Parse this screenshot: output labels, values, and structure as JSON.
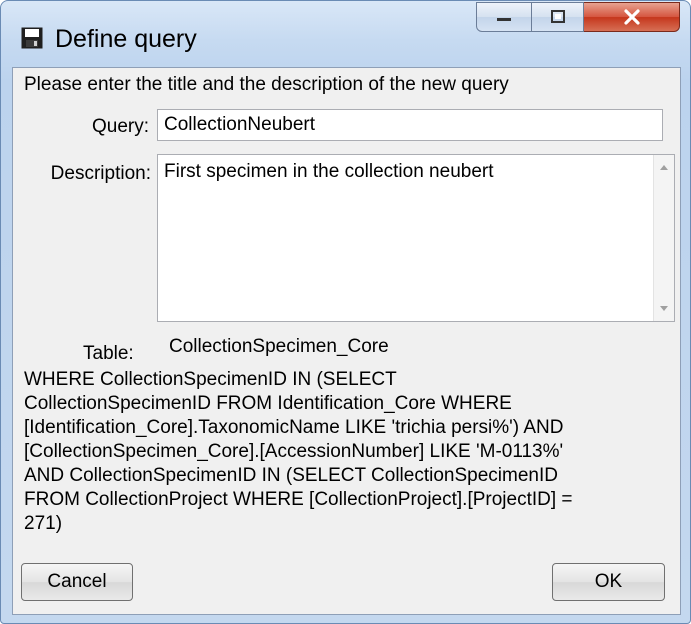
{
  "window": {
    "title": "Define query",
    "icon": "floppy-disk-icon"
  },
  "caption_buttons": [
    "minimize-icon",
    "maximize-icon",
    "close-icon"
  ],
  "dialog": {
    "prompt": "Please enter the title and the description of the new query",
    "query_label": "Query:",
    "query_value": "CollectionNeubert",
    "description_label": "Description:",
    "description_value": "First specimen in the collection neubert",
    "table_label": "Table:",
    "table_value": "CollectionSpecimen_Core",
    "sql_lines": [
      " WHERE CollectionSpecimenID IN (SELECT",
      "CollectionSpecimenID FROM Identification_Core WHERE",
      "[Identification_Core].TaxonomicName LIKE 'trichia persi%') AND",
      "[CollectionSpecimen_Core].[AccessionNumber] LIKE 'M-0113%'",
      "AND CollectionSpecimenID IN (SELECT CollectionSpecimenID",
      "FROM CollectionProject WHERE [CollectionProject].[ProjectID] =",
      "271)"
    ]
  },
  "buttons": {
    "cancel": "Cancel",
    "ok": "OK"
  },
  "colors": {
    "title_bar": "#c6daf1",
    "close_button": "#c5361c",
    "client_background": "#f0f0f0"
  }
}
